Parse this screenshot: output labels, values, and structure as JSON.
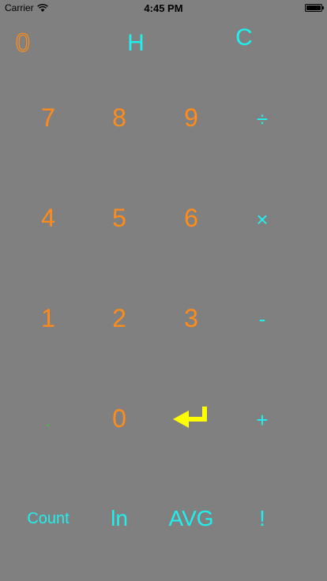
{
  "status_bar": {
    "carrier": "Carrier",
    "time": "4:45 PM",
    "icons": [
      "wifi-icon",
      "battery-icon"
    ]
  },
  "display": {
    "value": "0"
  },
  "top_buttons": {
    "h_label": "H",
    "c_label": "C"
  },
  "keypad": {
    "row1": [
      "7",
      "8",
      "9",
      "÷"
    ],
    "row2": [
      "4",
      "5",
      "6",
      "×"
    ],
    "row3": [
      "1",
      "2",
      "3",
      "-"
    ],
    "row4": [
      ".",
      "0",
      "enter-icon",
      "+"
    ],
    "row5": [
      "Count",
      "ln",
      "AVG",
      "!"
    ]
  },
  "colors": {
    "background": "#808080",
    "digits": "#ff8c1a",
    "operators": "#1ef0f0",
    "enter": "#ffff00",
    "dot": "#2ecc2e"
  }
}
